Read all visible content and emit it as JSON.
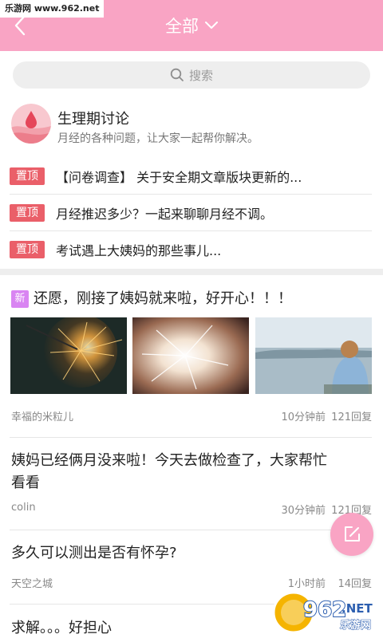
{
  "watermark": {
    "text": "乐游网 www.962.net"
  },
  "header": {
    "title": "全部",
    "accent": "#f9a4c4"
  },
  "search": {
    "placeholder": "搜索"
  },
  "forum": {
    "name": "生理期讨论",
    "desc": "月经的各种问题，让大家一起帮你解决。"
  },
  "pinned": [
    {
      "badge": "置顶",
      "text": "【问卷调查】 关于安全期文章版块更新的..."
    },
    {
      "badge": "置顶",
      "text": "月经推迟多少？一起来聊聊月经不调。"
    },
    {
      "badge": "置顶",
      "text": "考试遇上大姨妈的那些事儿..."
    }
  ],
  "posts": [
    {
      "badge": "新",
      "title": "还愿，刚接了姨妈就来啦，好开心！！！",
      "author": "幸福的米粒儿",
      "time": "10分钟前",
      "replies": "121回复"
    },
    {
      "title_line1": "姨妈已经俩月没来啦！今天去做检查了，大家帮忙",
      "title_line2": "看看",
      "author": "colin",
      "time": "30分钟前",
      "replies": "121回复"
    },
    {
      "title": "多久可以测出是否有怀孕?",
      "author": "天空之城",
      "time": "1小时前",
      "replies": "14回复"
    },
    {
      "title": "求解。。。好担心"
    }
  ],
  "logo": {
    "text": "962",
    "sub": "乐游网",
    "net": ".NET"
  },
  "colors": {
    "pin_badge": "#ea5f69",
    "new_badge": "#d985f2",
    "fab": "#f9a4c4"
  }
}
